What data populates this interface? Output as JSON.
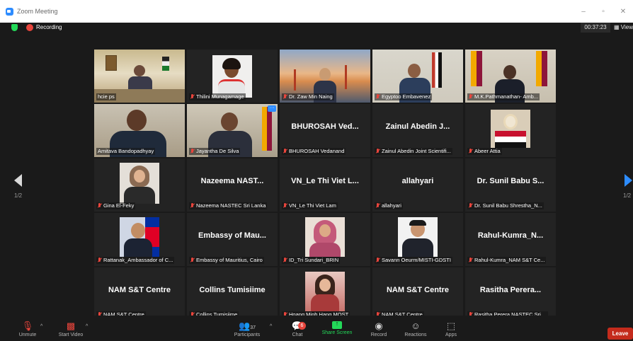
{
  "window": {
    "title": "Zoom Meeting",
    "controls": [
      "–",
      "▫",
      "✕"
    ]
  },
  "status": {
    "recording_label": "Recording",
    "timer": "00:37:23",
    "view_label": "View"
  },
  "pagination": {
    "left": "1/2",
    "right": "1/2"
  },
  "tiles": [
    {
      "label": "hcie ps",
      "big": "",
      "video": true,
      "muted": false
    },
    {
      "label": "Thilini Munagamage",
      "big": "",
      "video": true,
      "muted": true
    },
    {
      "label": "Dr. Zaw Min Naing",
      "big": "",
      "video": true,
      "muted": true
    },
    {
      "label": "Egyptoo Embavenez",
      "big": "",
      "video": true,
      "muted": true
    },
    {
      "label": "M.K.Pathmanathan- Amb...",
      "big": "",
      "video": true,
      "muted": true
    },
    {
      "label": "Amitava Bandopadhyay",
      "big": "",
      "video": true,
      "muted": false
    },
    {
      "label": "Jayantha De Silva",
      "big": "",
      "video": true,
      "muted": true
    },
    {
      "label": "BHUROSAH Vedanand",
      "big": "BHUROSAH Ved...",
      "video": false,
      "muted": true
    },
    {
      "label": "Zainul Abedin Joint Scientifi...",
      "big": "Zainul Abedin J...",
      "video": false,
      "muted": true
    },
    {
      "label": "Abeer Attia",
      "big": "",
      "video": true,
      "muted": true
    },
    {
      "label": "Gina El-Feky",
      "big": "",
      "video": true,
      "muted": true
    },
    {
      "label": "Nazeema NASTEC Sri Lanka",
      "big": "Nazeema NAST...",
      "video": false,
      "muted": true
    },
    {
      "label": "VN_Le Thi Viet Lam",
      "big": "VN_Le Thi Viet L...",
      "video": false,
      "muted": true
    },
    {
      "label": "allahyari",
      "big": "allahyari",
      "video": false,
      "muted": true
    },
    {
      "label": "Dr. Sunil Babu Shrestha_N...",
      "big": "Dr. Sunil Babu S...",
      "video": false,
      "muted": true
    },
    {
      "label": "Rattanak_Ambassador of C...",
      "big": "",
      "video": true,
      "muted": true
    },
    {
      "label": "Embassy of Mauritius, Cairo",
      "big": "Embassy of Mau...",
      "video": false,
      "muted": true
    },
    {
      "label": "ID_Tri Sundari_BRIN",
      "big": "",
      "video": true,
      "muted": true
    },
    {
      "label": "Savann Oeurm/MISTI-GDSTI",
      "big": "",
      "video": true,
      "muted": true
    },
    {
      "label": "Rahul-Kumra_NAM S&T Ce...",
      "big": "Rahul-Kumra_N...",
      "video": false,
      "muted": true
    },
    {
      "label": "NAM S&T Centre",
      "big": "NAM S&T Centre",
      "video": false,
      "muted": true
    },
    {
      "label": "Collins Tumisiime",
      "big": "Collins Tumisiime",
      "video": false,
      "muted": true
    },
    {
      "label": "Hoang Minh Hang MOST",
      "big": "",
      "video": true,
      "muted": true
    },
    {
      "label": "NAM S&T Centre",
      "big": "NAM S&T Centre",
      "video": false,
      "muted": true
    },
    {
      "label": "Rasitha Perera NASTEC Sri ...",
      "big": "Rasitha Perera...",
      "video": false,
      "muted": true
    }
  ],
  "toolbar": {
    "unmute": "Unmute",
    "start_video": "Start Video",
    "participants": "Participants",
    "participants_count": "37",
    "chat": "Chat",
    "chat_badge": "6",
    "share_screen": "Share Screen",
    "record": "Record",
    "reactions": "Reactions",
    "apps": "Apps",
    "leave": "Leave"
  },
  "colors": {
    "accent_blue": "#2d8cff",
    "rec_red": "#e8453c",
    "share_green": "#23d959",
    "active_speaker": "#d9d94a",
    "leave_red": "#c42b1c"
  }
}
